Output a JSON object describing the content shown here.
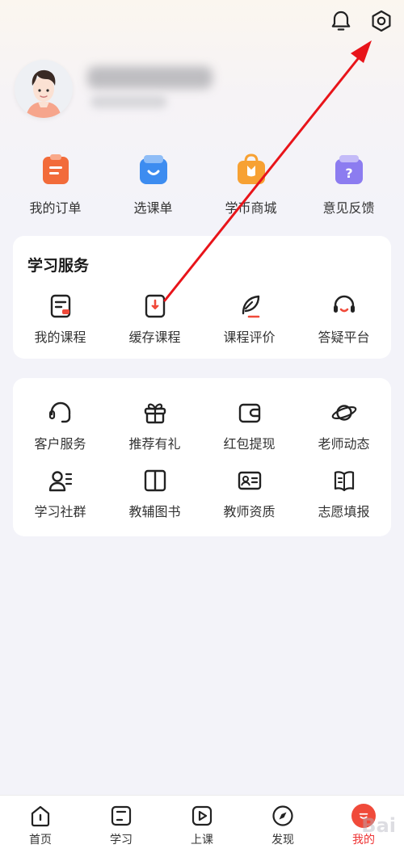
{
  "header": {
    "icons": [
      "bell-icon",
      "settings-gear-icon"
    ]
  },
  "profile": {
    "avatar": "avatar"
  },
  "quick_actions": [
    {
      "label": "我的订单",
      "icon": "order-icon",
      "color": "#f26b3a"
    },
    {
      "label": "选课单",
      "icon": "course-bag-icon",
      "color": "#3d8cf0"
    },
    {
      "label": "学币商城",
      "icon": "shop-bag-icon",
      "color": "#f7a133"
    },
    {
      "label": "意见反馈",
      "icon": "feedback-icon",
      "color": "#8c7cf0"
    }
  ],
  "study_services": {
    "title": "学习服务",
    "items": [
      {
        "label": "我的课程",
        "icon": "my-course-icon"
      },
      {
        "label": "缓存课程",
        "icon": "download-course-icon"
      },
      {
        "label": "课程评价",
        "icon": "feather-review-icon"
      },
      {
        "label": "答疑平台",
        "icon": "headset-qa-icon"
      }
    ]
  },
  "more_services": {
    "row1": [
      {
        "label": "客户服务",
        "icon": "customer-service-icon"
      },
      {
        "label": "推荐有礼",
        "icon": "gift-icon"
      },
      {
        "label": "红包提现",
        "icon": "wallet-icon"
      },
      {
        "label": "老师动态",
        "icon": "planet-icon"
      }
    ],
    "row2": [
      {
        "label": "学习社群",
        "icon": "community-icon"
      },
      {
        "label": "教辅图书",
        "icon": "book-icon"
      },
      {
        "label": "教师资质",
        "icon": "id-card-icon"
      },
      {
        "label": "志愿填报",
        "icon": "open-book-icon"
      }
    ]
  },
  "tabbar": {
    "tabs": [
      {
        "label": "首页",
        "icon": "home-icon"
      },
      {
        "label": "学习",
        "icon": "study-icon"
      },
      {
        "label": "上课",
        "icon": "play-icon"
      },
      {
        "label": "发现",
        "icon": "compass-icon"
      },
      {
        "label": "我的",
        "icon": "profile-icon"
      }
    ],
    "active_color": "#f04a3a"
  },
  "watermark": "Bai"
}
